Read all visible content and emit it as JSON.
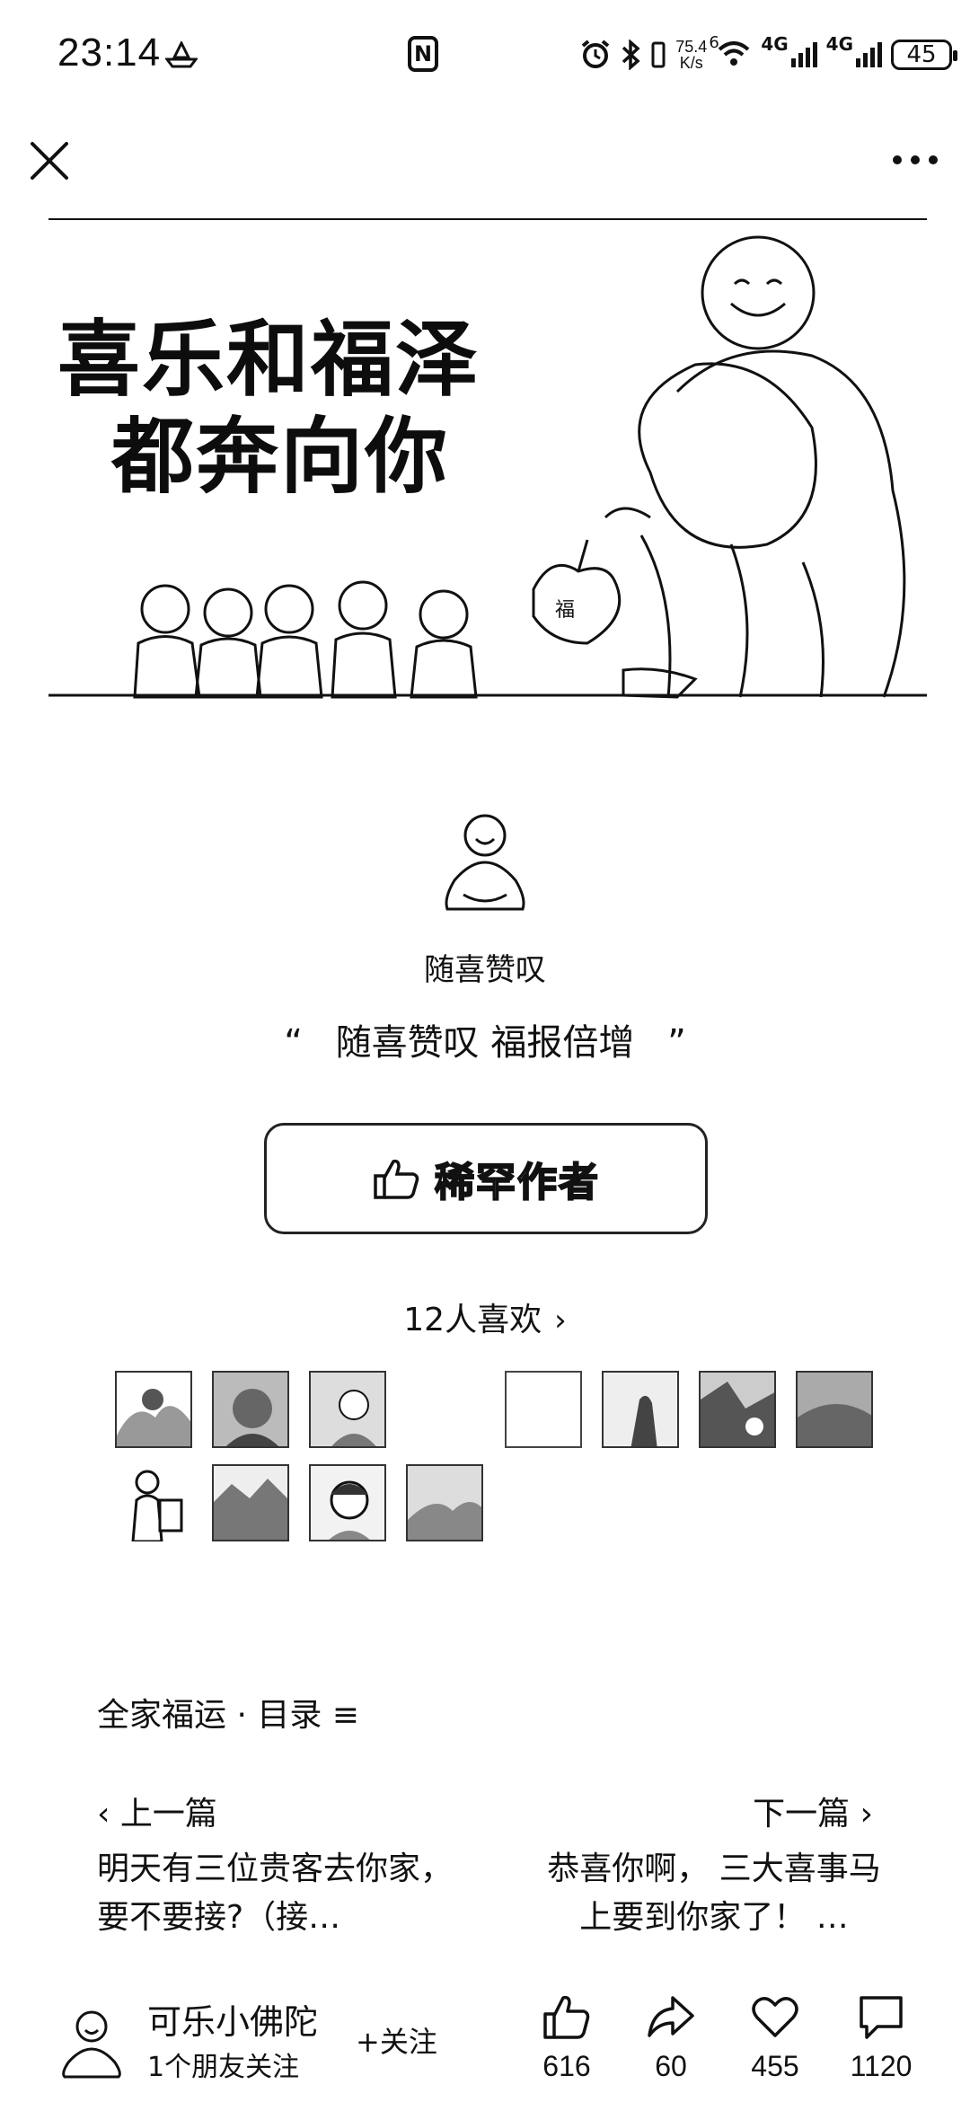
{
  "status_bar": {
    "time": "23:14",
    "net_speed_value": "75.4",
    "net_speed_unit": "K/s",
    "wifi_label": "6",
    "sim1_label": "4G",
    "sim2_label": "4G",
    "battery": "45",
    "nfc": "N"
  },
  "banner": {
    "line1": "喜乐和福泽",
    "line2": "都奔向你",
    "bag_mark": "福"
  },
  "author": {
    "name": "随喜赞叹",
    "quote_open": "“",
    "quote_text": "随喜赞叹 福报倍增",
    "quote_close": "”"
  },
  "reward": {
    "label": "稀罕作者"
  },
  "likes": {
    "label": "12人喜欢",
    "chevron": "›"
  },
  "series": {
    "text": "全家福运 · 目录 ≡"
  },
  "nav": {
    "prev_label": "‹ 上一篇",
    "next_label": "下一篇 ›",
    "prev_title": "明天有三位贵客去你家，要不要接?（接…",
    "next_title": "恭喜你啊， 三大喜事马上要到你家了！ …"
  },
  "account": {
    "name": "可乐小佛陀",
    "subtitle": "1个朋友关注",
    "follow_label": "+关注"
  },
  "actions": {
    "like_count": "616",
    "share_count": "60",
    "favorite_count": "455",
    "comment_count": "1120"
  }
}
